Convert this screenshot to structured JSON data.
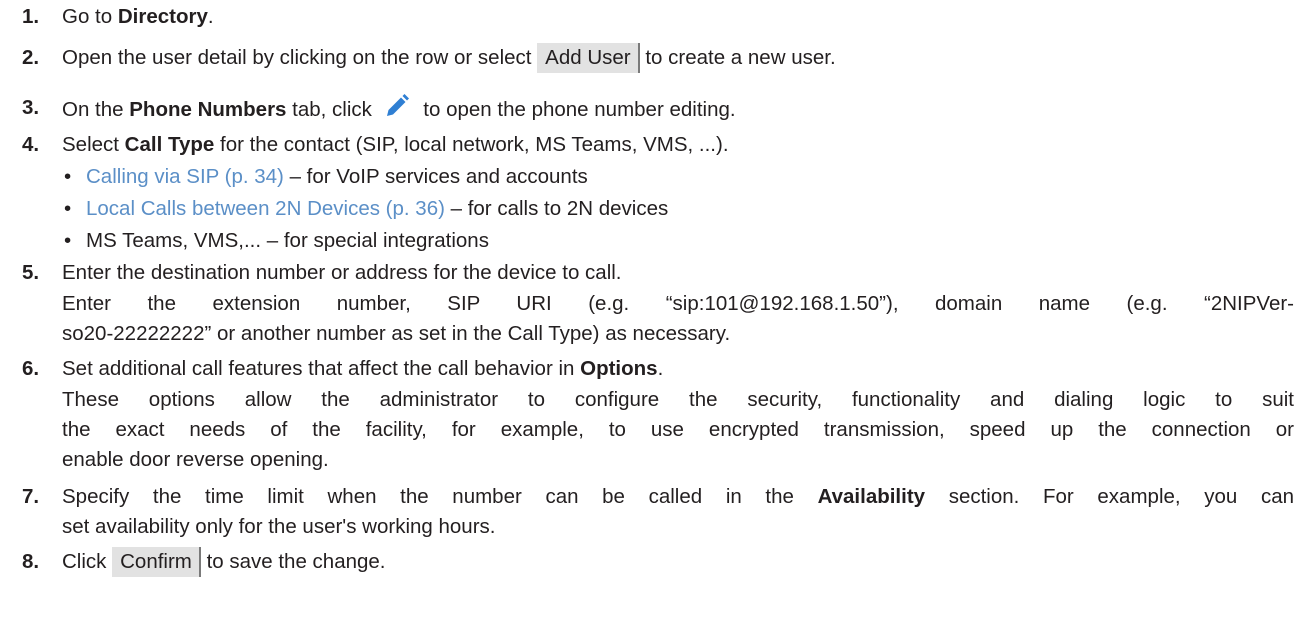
{
  "steps": [
    {
      "num": "1.",
      "pre": "Go to ",
      "bold": "Directory",
      "post": "."
    },
    {
      "num": "2.",
      "pre": "Open the user detail by clicking on the row or select ",
      "button": "Add User",
      "post": " to create a new user."
    },
    {
      "num": "3.",
      "pre": "On the ",
      "bold": "Phone Numbers",
      "mid": " tab, click ",
      "icon": "pencil-edit-icon",
      "post": " to open the phone number editing."
    },
    {
      "num": "4.",
      "pre": "Select ",
      "bold": "Call Type",
      "post": " for the contact (SIP, local network, MS Teams, VMS, ...)."
    },
    {
      "num": "5.",
      "text": "Enter the destination number or address for the device to call.",
      "para": "Enter the extension number, SIP URI (e.g. “sip:101@192.168.1.50”), domain name (e.g. “2NIPVer-so20-22222222” or another number as set in the Call Type) as necessary."
    },
    {
      "num": "6.",
      "pre": "Set additional call features that affect the call behavior in ",
      "bold": "Options",
      "post": ".",
      "para": "These options allow the administrator to configure the security, functionality and dialing logic to suit the exact needs of the facility, for example, to use encrypted transmission, speed up the connection or enable door reverse opening."
    },
    {
      "num": "7.",
      "pre": "Specify the time limit when the number can be called in the ",
      "bold": "Availability",
      "post": " section. For example, you can set availability only for the user's working hours."
    },
    {
      "num": "8.",
      "pre": "Click ",
      "button": "Confirm",
      "post": " to save the change."
    }
  ],
  "bullets": [
    {
      "link": "Calling via SIP (p. 34)",
      "text": " – for VoIP services and accounts"
    },
    {
      "link": "Local Calls between 2N Devices (p. 36)",
      "text": " – for calls to 2N devices"
    },
    {
      "text": "MS Teams, VMS,... – for special integrations"
    }
  ],
  "bullet_char": "•",
  "colors": {
    "link": "#5b8fc7",
    "text": "#231f20",
    "pencil": "#2f7fd3",
    "button_bg": "#e2e2e2"
  },
  "para5_lines": [
    "Enter the extension number, SIP URI (e.g. “sip:101@192.168.1.50”), domain name (e.g. “2NIPVer-",
    "so20-22222222” or another number as set in the Call Type) as necessary."
  ],
  "para6_lines": [
    "These options allow the administrator to configure the security, functionality and dialing logic to suit",
    "the exact needs of the facility, for example, to use encrypted transmission, speed up the connection or",
    "enable door reverse opening."
  ],
  "step7_lines": [
    "Specify the time limit when the number can be called in the ",
    "Availability",
    " section. For example, you can",
    "set availability only for the user's working hours."
  ]
}
